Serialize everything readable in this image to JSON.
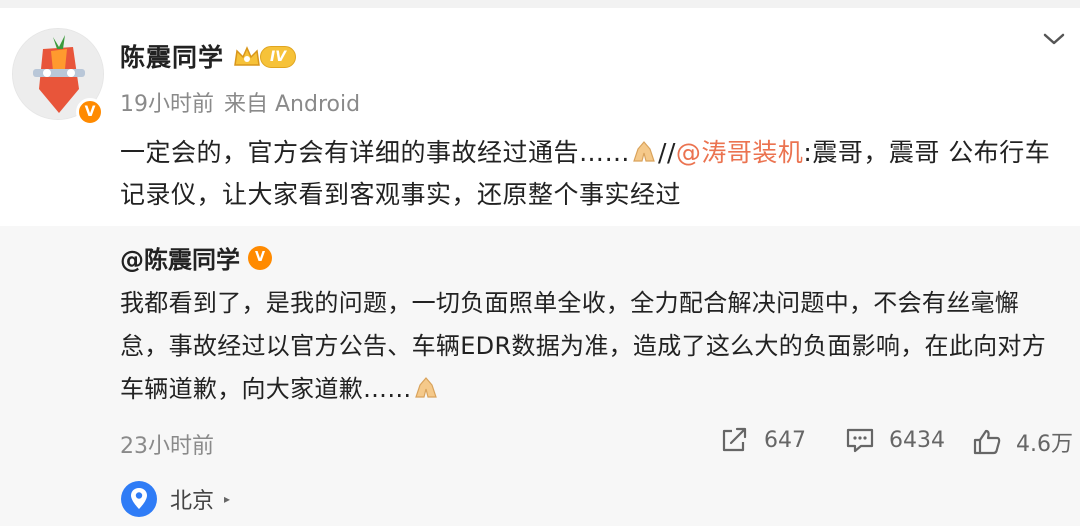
{
  "post": {
    "author": "陈震同学",
    "level": "IV",
    "time": "19小时前",
    "source": "来自 Android",
    "text_part1": "一定会的，官方会有详细的事故经过通告……",
    "text_sep": "//",
    "mention": "@涛哥装机",
    "text_part2": ":震哥，震哥 公布行车记录仪，让大家看到客观事实，还原整个事实经过"
  },
  "quoted": {
    "author": "@陈震同学",
    "text_part1": "我都看到了，是我的问题，一切负面照单全收，全力配合解决问题中，不会有丝毫懈怠，事故经过以官方公告、车辆EDR数据为准，造成了这么大的负面影响，在此向对方车辆道歉，向大家道歉……",
    "time": "23小时前",
    "shares": "647",
    "comments": "6434",
    "likes": "4.6万",
    "location": "北京"
  },
  "icons": {
    "verified": "v-badge-icon",
    "crown": "crown-icon",
    "chevron": "chevron-down-icon",
    "share": "share-icon",
    "comment": "comment-icon",
    "like": "thumbs-up-icon",
    "location": "location-pin-icon",
    "emoji": "praying-hands-emoji"
  },
  "colors": {
    "mention": "#eb7350",
    "verified": "#ff8a00",
    "location": "#2f7cf6",
    "quote_bg": "#f7f7f7"
  }
}
